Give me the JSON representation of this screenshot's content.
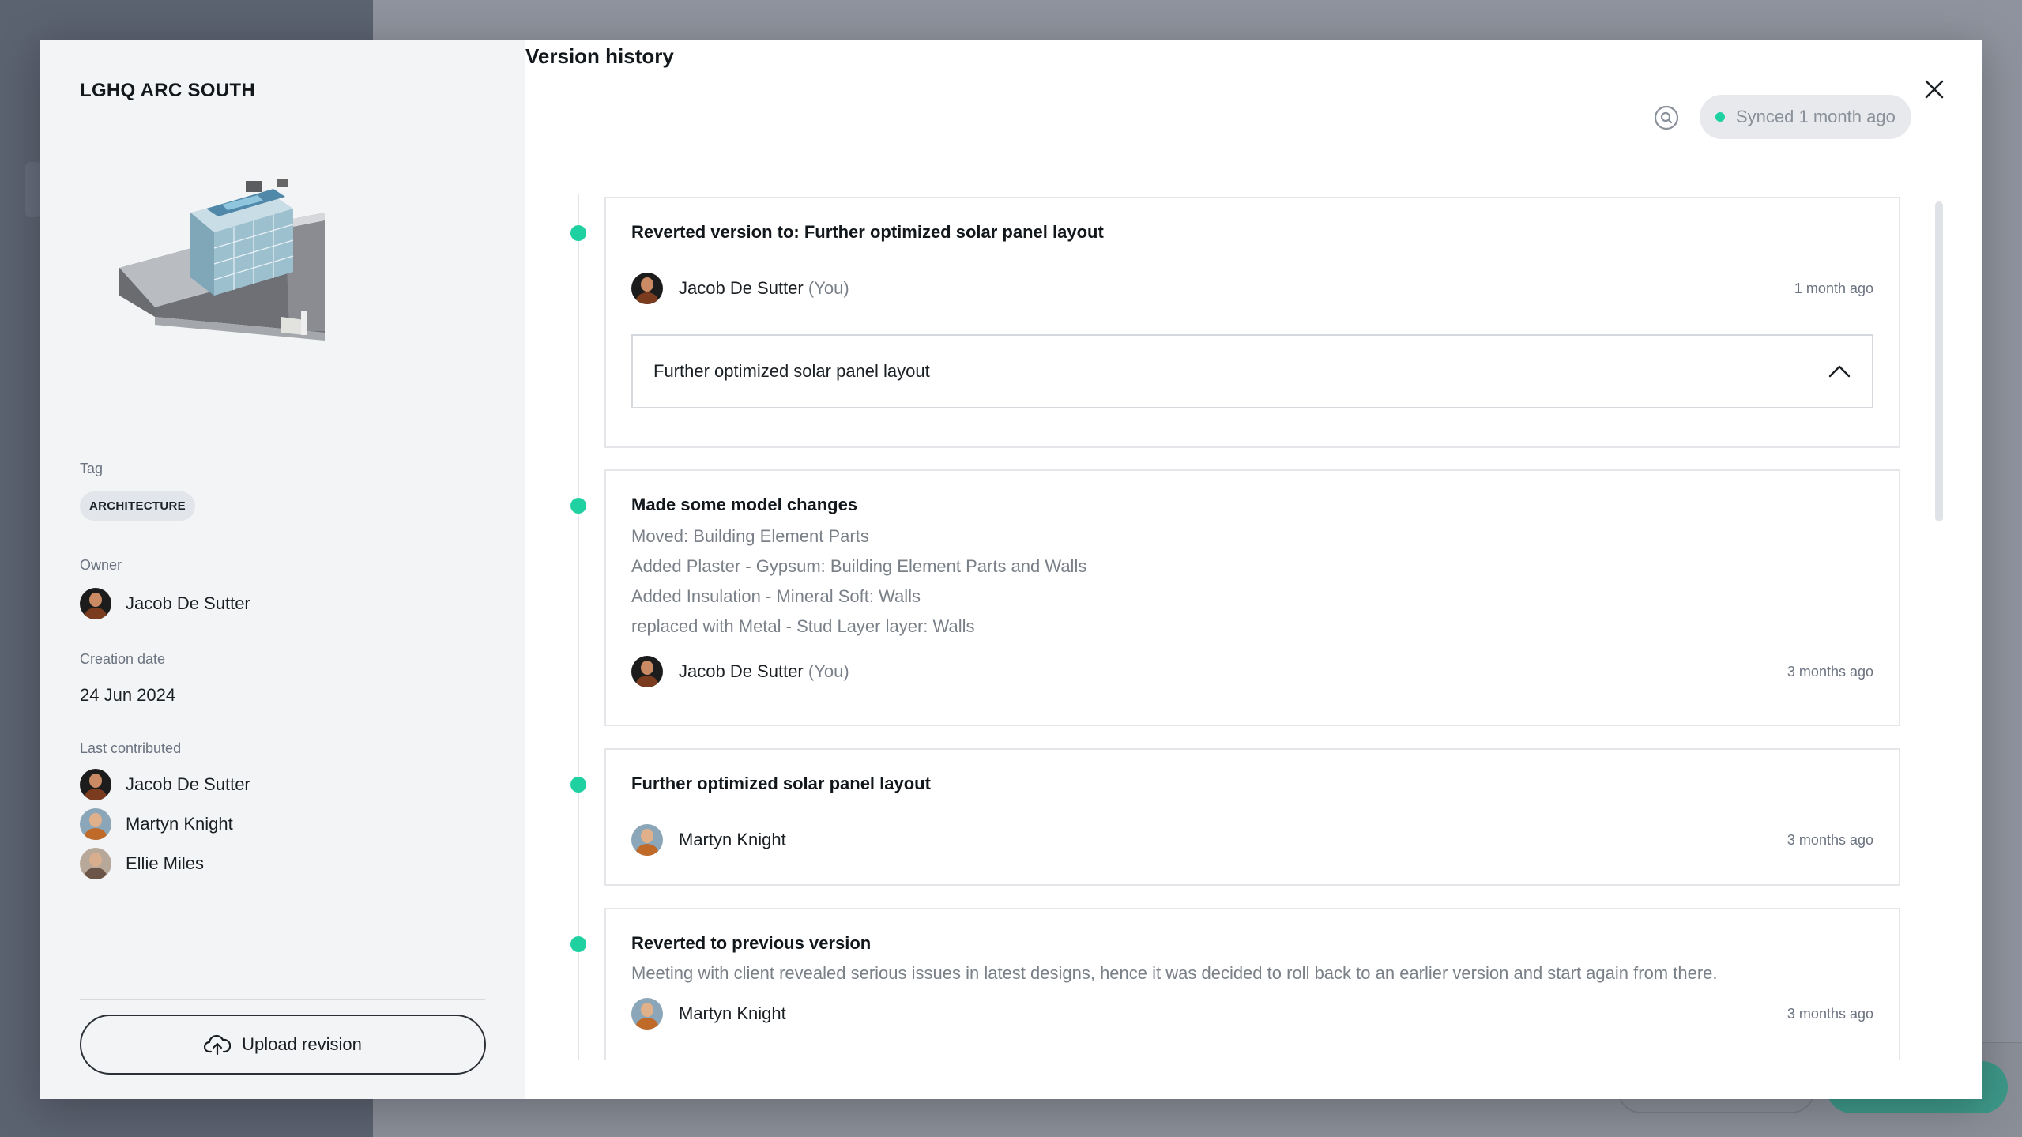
{
  "colors": {
    "accent": "#1fd1a1",
    "overlay_bg": "#8f939d",
    "side_bg": "#f3f4f6"
  },
  "project": {
    "title": "LGHQ ARC SOUTH",
    "tag_label": "Tag",
    "tag_value": "ARCHITECTURE",
    "owner_label": "Owner",
    "owner_name": "Jacob De Sutter",
    "creation_label": "Creation date",
    "creation_date": "24 Jun 2024",
    "contrib_label": "Last contributed",
    "contributors": [
      "Jacob De Sutter",
      "Martyn Knight",
      "Ellie Miles"
    ],
    "upload_label": "Upload revision"
  },
  "history": {
    "title": "Version history",
    "sync_status": "Synced 1 month ago",
    "versions": [
      {
        "title": "Reverted version to: Further optimized solar panel layout",
        "author": "Jacob De Sutter",
        "you": "(You)",
        "ago": "1 month ago",
        "expander_text": "Further optimized solar panel layout"
      },
      {
        "title": "Made some model changes",
        "changes": [
          "Moved: Building Element Parts",
          "Added Plaster - Gypsum: Building Element Parts and Walls",
          "Added Insulation - Mineral Soft: Walls",
          "replaced with Metal - Stud Layer layer: Walls"
        ],
        "author": "Jacob De Sutter",
        "you": "(You)",
        "ago": "3 months ago"
      },
      {
        "title": "Further optimized solar panel layout",
        "author": "Martyn Knight",
        "ago": "3 months ago"
      },
      {
        "title": "Reverted to previous version",
        "desc": "Meeting with client revealed serious issues in latest designs, hence it was decided to roll back to an earlier version and start again from there.",
        "author": "Martyn Knight",
        "ago": "3 months ago"
      }
    ]
  }
}
